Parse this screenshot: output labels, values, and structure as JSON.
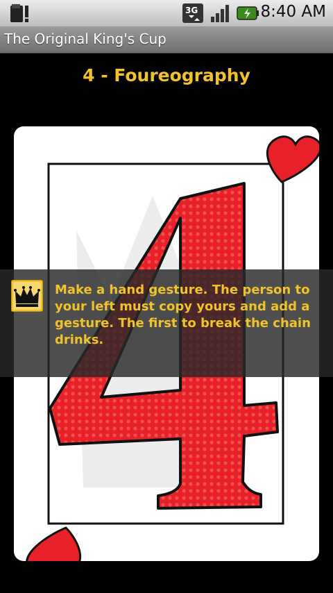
{
  "status_bar": {
    "time": "8:40 AM",
    "network": "3G"
  },
  "app": {
    "title": "The Original King's Cup"
  },
  "card": {
    "title": "4 - Foureography",
    "rank": "4",
    "suit": "hearts",
    "rule": "Make a hand gesture. The person to your left must copy yours and add a gesture. The first to break the chain drinks."
  },
  "colors": {
    "title_yellow": "#f2c22b",
    "card_red": "#e8202a"
  },
  "icons": {
    "rule_icon": "crown-icon"
  }
}
